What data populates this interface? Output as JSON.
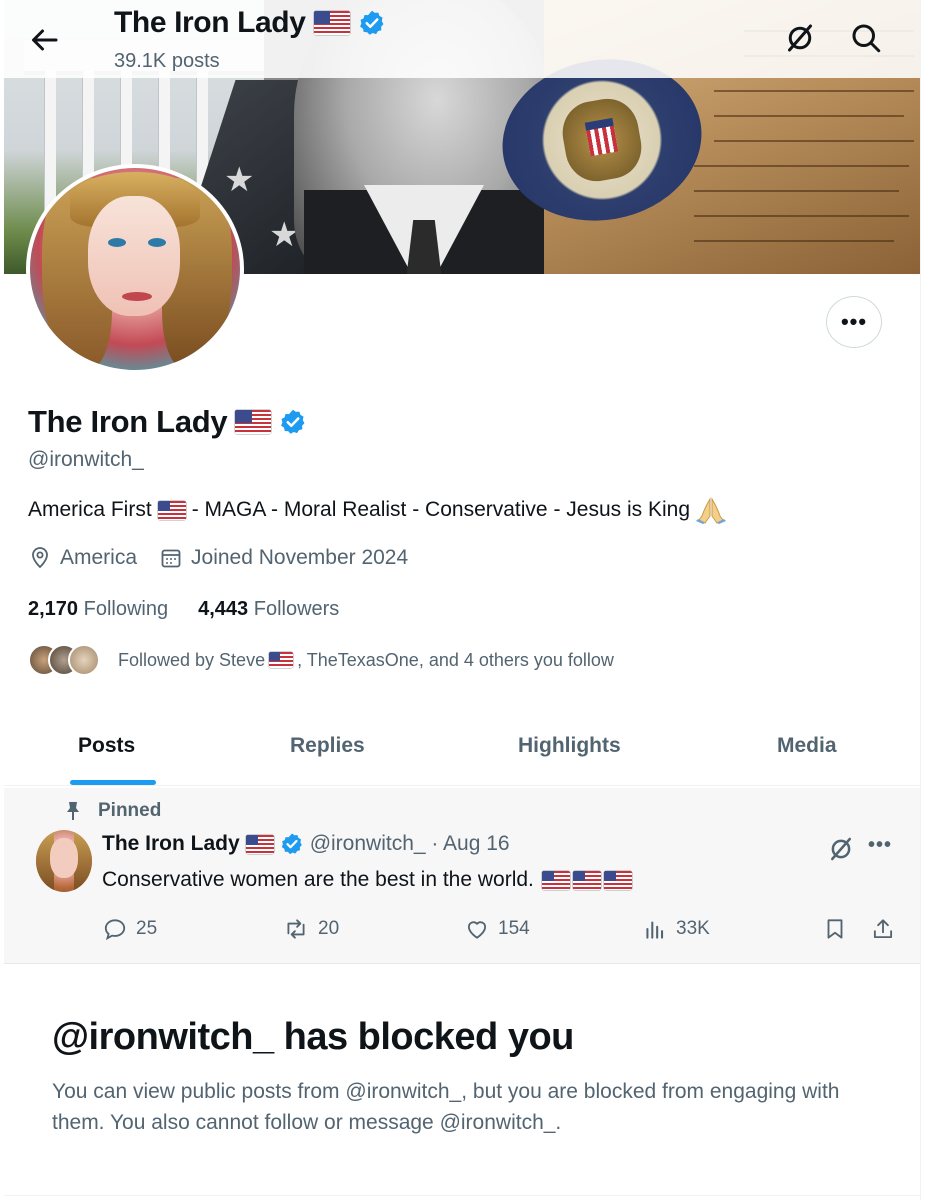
{
  "header": {
    "title": "The Iron Lady",
    "posts_count": "39.1K posts"
  },
  "profile": {
    "display_name": "The Iron Lady",
    "handle": "@ironwitch_",
    "bio": {
      "part1": "America First",
      "part2": "- MAGA - Moral Realist - Conservative - Jesus is King"
    },
    "location": "America",
    "joined": "Joined November 2024",
    "following_count": "2,170",
    "following_label": "Following",
    "followers_count": "4,443",
    "followers_label": "Followers",
    "followed_by": {
      "prefix": "Followed by Steve",
      "suffix": ", TheTexasOne, and 4 others you follow"
    }
  },
  "tabs": [
    {
      "label": "Posts",
      "active": true
    },
    {
      "label": "Replies",
      "active": false
    },
    {
      "label": "Highlights",
      "active": false
    },
    {
      "label": "Media",
      "active": false
    }
  ],
  "pinned_post": {
    "pinned_label": "Pinned",
    "author": "The Iron Lady",
    "handle_date": "@ironwitch_ · Aug 16",
    "text": "Conservative women are the best in the world.",
    "replies": "25",
    "reposts": "20",
    "likes": "154",
    "views": "33K"
  },
  "blocked": {
    "title": "@ironwitch_ has blocked you",
    "body": "You can view public posts from @ironwitch_, but you are blocked from engaging with them. You also cannot follow or message @ironwitch_."
  },
  "colors": {
    "accent": "#1d9bf0",
    "text": "#0f1419",
    "muted": "#536471"
  }
}
